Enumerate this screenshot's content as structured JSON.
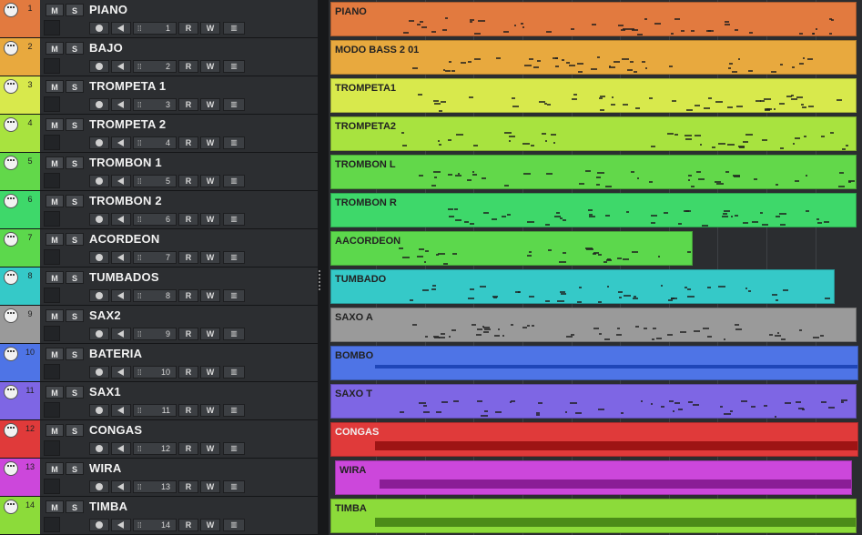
{
  "tracks": [
    {
      "num": "1",
      "name": "PIANO",
      "channel": "1",
      "color": "#e27a3f"
    },
    {
      "num": "2",
      "name": "BAJO",
      "channel": "2",
      "color": "#e8a93e"
    },
    {
      "num": "3",
      "name": "TROMPETA 1",
      "channel": "3",
      "color": "#d8e94c"
    },
    {
      "num": "4",
      "name": "TROMPETA 2",
      "channel": "4",
      "color": "#a8e33f"
    },
    {
      "num": "5",
      "name": "TROMBON 1",
      "channel": "5",
      "color": "#62d84a"
    },
    {
      "num": "6",
      "name": "TROMBON 2",
      "channel": "6",
      "color": "#3ed86a"
    },
    {
      "num": "7",
      "name": "ACORDEON",
      "channel": "7",
      "color": "#5cd84c"
    },
    {
      "num": "8",
      "name": "TUMBADOS",
      "channel": "8",
      "color": "#35c9c8"
    },
    {
      "num": "9",
      "name": "SAX2",
      "channel": "9",
      "color": "#9a9a9a"
    },
    {
      "num": "10",
      "name": "BATERIA",
      "channel": "10",
      "color": "#4e74e6"
    },
    {
      "num": "11",
      "name": "SAX1",
      "channel": "11",
      "color": "#7e66e4"
    },
    {
      "num": "12",
      "name": "CONGAS",
      "channel": "12",
      "color": "#e03a3a"
    },
    {
      "num": "13",
      "name": "WIRA",
      "channel": "13",
      "color": "#cc47db"
    },
    {
      "num": "14",
      "name": "TIMBA",
      "channel": "14",
      "color": "#8cdb3a"
    }
  ],
  "buttons": {
    "mute": "M",
    "solo": "S",
    "read": "R",
    "write": "W",
    "grid_glyph": "⁞⁞",
    "editor_glyph": "▥"
  },
  "clips": [
    {
      "track": 1,
      "name": "PIANO",
      "color": "#e27a3f",
      "light": false,
      "wave": false
    },
    {
      "track": 2,
      "name": "MODO BASS 2 01",
      "color": "#e8a93e",
      "light": false,
      "wave": false
    },
    {
      "track": 3,
      "name": "TROMPETA1",
      "color": "#d8e94c",
      "light": false,
      "wave": false
    },
    {
      "track": 4,
      "name": "TROMPETA2",
      "color": "#a8e33f",
      "light": false,
      "wave": false
    },
    {
      "track": 5,
      "name": "TROMBON L",
      "color": "#62d84a",
      "light": false,
      "wave": false
    },
    {
      "track": 6,
      "name": "TROMBON R",
      "color": "#3ed86a",
      "light": false,
      "wave": false
    },
    {
      "track": 7,
      "name": "AACORDEON",
      "color": "#5cd84c",
      "light": false,
      "wave": false
    },
    {
      "track": 8,
      "name": "TUMBADO",
      "color": "#35c9c8",
      "light": false,
      "wave": false
    },
    {
      "track": 9,
      "name": "SAXO A",
      "color": "#9a9a9a",
      "light": false,
      "wave": false
    },
    {
      "track": 10,
      "name": "BOMBO",
      "color": "#4e74e6",
      "light": false,
      "wave": true,
      "wave_color": "#1f46b8"
    },
    {
      "track": 11,
      "name": "SAXO T",
      "color": "#7e66e4",
      "light": false,
      "wave": false
    },
    {
      "track": 12,
      "name": "CONGAS",
      "color": "#e03a3a",
      "light": true,
      "wave": true,
      "wave_color": "#9e1414"
    },
    {
      "track": 13,
      "name": "WIRA",
      "color": "#cc47db",
      "light": false,
      "wave": true,
      "wave_color": "#8a1d96"
    },
    {
      "track": 14,
      "name": "TIMBA",
      "color": "#8cdb3a",
      "light": false,
      "wave": true,
      "wave_color": "#4b8c18"
    }
  ]
}
